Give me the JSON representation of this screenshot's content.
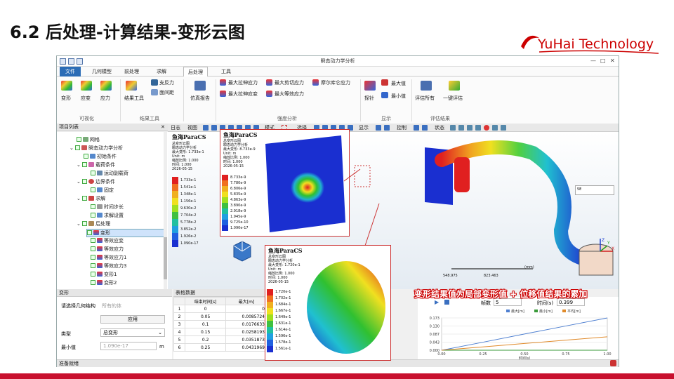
{
  "slide": {
    "title": "6.2 后处理-计算结果-变形云图",
    "caption": "变形结果值为局部变形值 + 位移值结果的累加"
  },
  "logo": {
    "text": "YuHai Technology",
    "accent": "#cc0000"
  },
  "app": {
    "title": "瞬态动力学分析",
    "menu": [
      "文件",
      "几何模型",
      "前处理",
      "求解",
      "后处理",
      "工具"
    ],
    "ribbon": {
      "vis_buttons": [
        "变形",
        "应变",
        "应力"
      ],
      "vis_group": "可视化",
      "result_buttons": [
        "结果工具",
        "支反力",
        "面间距"
      ],
      "result_group": "结果工具",
      "report": "仿真报告",
      "strength": [
        "最大拉伸应力",
        "最大剪切应力",
        "摩尔库仑应力",
        "最大拉伸应变",
        "最大等效应力"
      ],
      "strength_group": "强度分析",
      "display": [
        "探针",
        "最大值",
        "最小值"
      ],
      "display_group": "显示",
      "eval": [
        "评估所有",
        "一键评估"
      ],
      "eval_group": "评估结果"
    },
    "toolbar": [
      "日志",
      "视图",
      "模式",
      "选择",
      "显示",
      "控制",
      "状态"
    ],
    "tree": {
      "header": "项目列表",
      "items": [
        "网格",
        "瞬态动力学分析",
        "初始条件",
        "载荷条件",
        "运动副载荷",
        "边界条件",
        "固定",
        "求解",
        "时间步长",
        "求解设置",
        "后处理",
        "变形",
        "等效应变",
        "等效应力",
        "等效应力1",
        "等效应力3",
        "变形1",
        "变形2"
      ]
    },
    "props": {
      "header": "变形",
      "geom_label": "请选择几何结构",
      "geom_value": "所有的体",
      "apply": "应用",
      "type_label": "类型",
      "type_value": "总变形",
      "min_label": "最小值",
      "min_value": "1.090e-17",
      "min_unit": "m"
    },
    "table": {
      "header": "表格数据",
      "columns": [
        "",
        "结束时间[s]",
        "最大[m]"
      ],
      "rows": [
        [
          "1",
          "0",
          "0"
        ],
        [
          "2",
          "0.05",
          "0.0085724"
        ],
        [
          "3",
          "0.1",
          "0.0176633"
        ],
        [
          "4",
          "0.15",
          "0.0258193"
        ],
        [
          "5",
          "0.2",
          "0.0351873"
        ],
        [
          "6",
          "0.25",
          "0.0431969"
        ]
      ]
    },
    "chart_panel": {
      "frame_label": "帧数",
      "frame_value": "5",
      "time_label": "时间(s)",
      "time_value": "0.399"
    },
    "status": "准备就绪",
    "viewport": {
      "logo": "鱼海ParaCS",
      "info": "总变形云图\n瞬态动力学分析\n最大变形: 1.733e-1\nUnit: m\n缩放比例: 1.000\n时间: 1.000\n2026-05-15",
      "legend": [
        "1.733e-1",
        "1.541e-1",
        "1.348e-1",
        "1.156e-1",
        "9.630e-2",
        "7.704e-2",
        "5.778e-2",
        "3.852e-2",
        "1.926e-2",
        "1.090e-17"
      ],
      "scale_labels": [
        "548.975",
        "823.463"
      ],
      "scale_unit": "(mm)",
      "mini": "5E"
    },
    "zoom1": {
      "logo": "鱼海ParaCS",
      "info": "总变形云图\n瞬态动力学分析\n最大变形: 8.733e-9\nUnit: m\n缩放比例: 1.000\n时间: 1.000\n2026-05-15",
      "legend": [
        "8.733e-9",
        "7.780e-9",
        "6.806e-9",
        "5.835e-9",
        "4.863e-9",
        "3.890e-9",
        "2.918e-9",
        "1.945e-9",
        "9.725e-10",
        "1.090e-17"
      ]
    },
    "zoom2": {
      "logo": "鱼海ParaCS",
      "info": "总变形云图\n瞬态动力学分析\n最大变形: 1.720e-1\nUnit: m\n缩放比例: 1.000\n时间: 1.000\n2026-05-15",
      "legend": [
        "1.720e-1",
        "1.702e-1",
        "1.684e-1",
        "1.667e-1",
        "1.649e-1",
        "1.631e-1",
        "1.614e-1",
        "1.596e-1",
        "1.578e-1",
        "1.561e-1"
      ]
    }
  },
  "chart_data": {
    "type": "line",
    "series": [
      {
        "name": "最大[m]"
      },
      {
        "name": "最小[m]"
      },
      {
        "name": "平均[m]"
      }
    ],
    "x": [
      0,
      0.25,
      0.5,
      0.75,
      1.0
    ],
    "x_ticks": [
      "0.00",
      "0.25",
      "0.50",
      "0.75",
      "1.00"
    ],
    "y_ticks": [
      "0.173",
      "0.130",
      "0.087",
      "0.043",
      "0.000"
    ],
    "xlabel": "时间[s]",
    "xlim": [
      0,
      1.0
    ],
    "ylim": [
      0,
      0.173
    ],
    "max_values": [
      0,
      0.043,
      0.087,
      0.13,
      0.173
    ],
    "min_values": [
      0,
      0,
      0,
      0,
      0
    ],
    "avg_values": [
      0,
      0.018,
      0.036,
      0.054,
      0.072
    ],
    "colors": {
      "max": "#4e7fd0",
      "min": "#3a9a3a",
      "avg": "#e08a2a"
    }
  }
}
